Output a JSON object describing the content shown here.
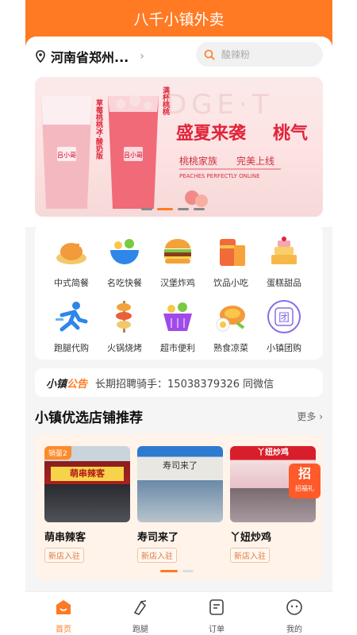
{
  "app": {
    "title": "八千小镇外卖"
  },
  "header": {
    "location": "河南省郑州...",
    "search_placeholder": "酸辣粉"
  },
  "banner": {
    "cup_left_label": "草莓桃桃冰·酸奶版",
    "cup_right_label": "满杯桃桃",
    "cup_brand": "吕小哥",
    "headline_main": "盛夏来袭",
    "headline_side": "桃气",
    "sub1": "桃桃家族",
    "sub2": "完美上线",
    "en_line": "PEACHES PERFECTLY ONLINE",
    "bg_text": "DGE·T"
  },
  "categories": [
    {
      "label": "中式简餐",
      "icon": "roast-chicken-icon"
    },
    {
      "label": "名吃快餐",
      "icon": "bowl-icon"
    },
    {
      "label": "汉堡炸鸡",
      "icon": "burger-icon"
    },
    {
      "label": "饮品小吃",
      "icon": "drink-icon"
    },
    {
      "label": "蛋糕甜品",
      "icon": "cake-icon"
    },
    {
      "label": "跑腿代购",
      "icon": "runner-icon"
    },
    {
      "label": "火锅烧烤",
      "icon": "skewer-icon"
    },
    {
      "label": "超市便利",
      "icon": "basket-icon"
    },
    {
      "label": "熟食凉菜",
      "icon": "cold-dish-icon"
    },
    {
      "label": "小镇团购",
      "icon": "group-buy-icon",
      "glyph": "团"
    }
  ],
  "notice": {
    "brand_a": "小镇",
    "brand_b": "公告",
    "text": "长期招聘骑手：15038379326 同微信"
  },
  "shops_section": {
    "title": "小镇优选店铺推荐",
    "more": "更多 ›"
  },
  "shops": [
    {
      "name": "萌串辣客",
      "tag": "新店入驻",
      "badge": "销量2",
      "sign": "萌串辣客"
    },
    {
      "name": "寿司来了",
      "tag": "新店入驻",
      "sign": "寿司来了"
    },
    {
      "name": "丫妞炒鸡",
      "tag": "新店入驻",
      "sign": "丫妞炒鸡",
      "promo": "招",
      "promo_sub": "招福礼"
    }
  ],
  "tabs": [
    {
      "label": "首页",
      "icon": "home-icon",
      "active": true
    },
    {
      "label": "跑腿",
      "icon": "errand-icon"
    },
    {
      "label": "订单",
      "icon": "order-icon"
    },
    {
      "label": "我的",
      "icon": "profile-icon"
    }
  ],
  "colors": {
    "accent": "#ff7a22",
    "banner_red": "#e0243a"
  }
}
